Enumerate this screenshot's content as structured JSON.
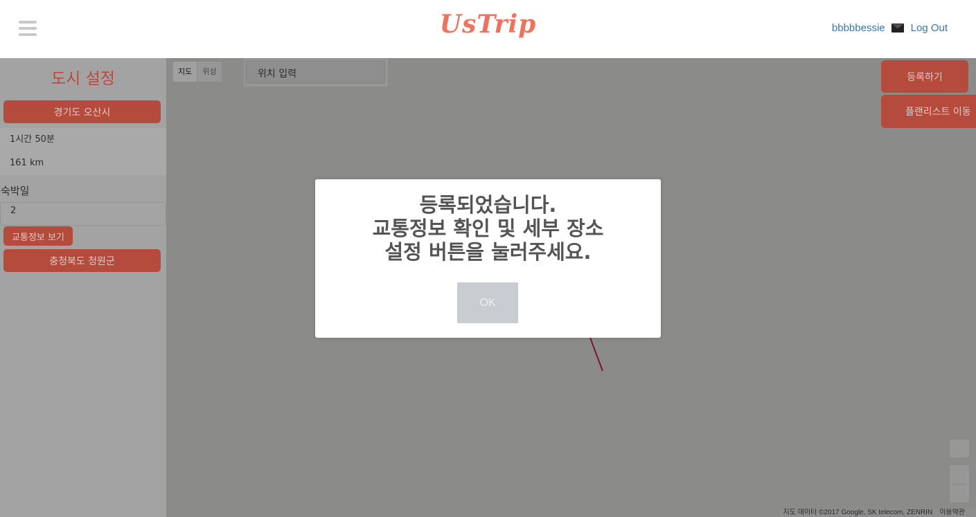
{
  "header": {
    "logo": "UsTrip",
    "username": "bbbbbessie",
    "logout_label": "Log Out"
  },
  "sidebar": {
    "title": "도시 설정",
    "start_city": "경기도 오산시",
    "duration": "1시간 50분",
    "distance": "161 km",
    "stay_label": "숙박일",
    "stay_value": "2",
    "traffic_button": "교통정보 보기",
    "dest_city": "충청북도 청원군"
  },
  "map": {
    "map_type_map": "지도",
    "map_type_satellite": "위성",
    "location_placeholder": "위치 입력",
    "register_button": "등록하기",
    "planlist_button": "플랜리스트 이동",
    "footer_attribution": "지도 데이터 ©2017 Google, SK telecom, ZENRIN",
    "footer_terms": "이용약관",
    "route_color": "#7a1530"
  },
  "modal": {
    "line1": "등록되었습니다.",
    "line2": "교통정보 확인 및 세부 장소",
    "line3": "설정 버튼을 눌러주세요.",
    "ok_label": "OK"
  }
}
